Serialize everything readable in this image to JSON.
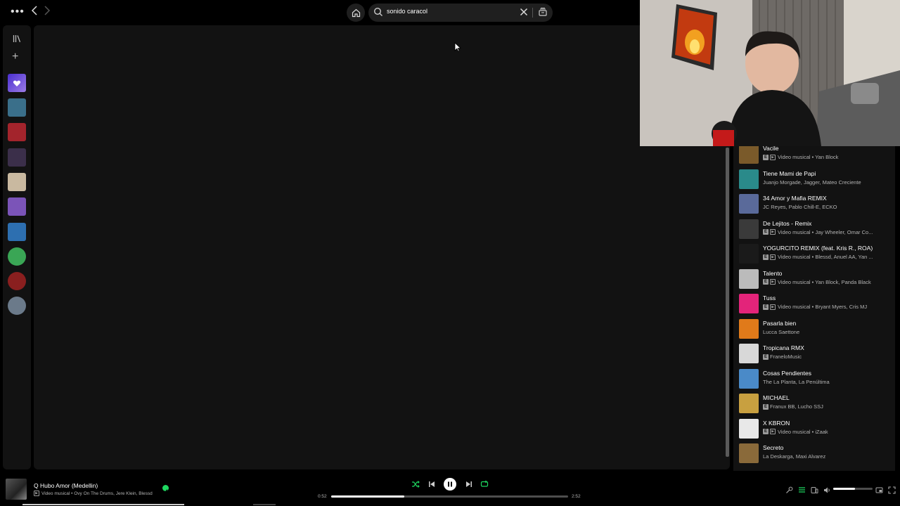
{
  "search": {
    "query": "sonido caracol"
  },
  "sidebar": {
    "items": [
      {
        "name": "liked-songs",
        "color": "#6b4bd6"
      },
      {
        "name": "playlist-1",
        "color": "#3a6f8a"
      },
      {
        "name": "playlist-2",
        "color": "#a3242c"
      },
      {
        "name": "playlist-3",
        "color": "#3b2f4a"
      },
      {
        "name": "playlist-4",
        "color": "#c9b9a0"
      },
      {
        "name": "playlist-5",
        "color": "#7b54b8"
      },
      {
        "name": "playlist-6",
        "color": "#2d6fb0"
      },
      {
        "name": "artist-1",
        "color": "#3aa655"
      },
      {
        "name": "artist-2",
        "color": "#8a1f1f"
      },
      {
        "name": "artist-3",
        "color": "#6b7a8a"
      }
    ]
  },
  "queue": {
    "items": [
      {
        "title": "Vacile",
        "explicit": true,
        "video": true,
        "meta": "Video musical • Yan Block",
        "thumb": "#7a5a2a"
      },
      {
        "title": "Tiene Mami de Papi",
        "explicit": false,
        "video": false,
        "meta": "Juanjo Morgade, Jagger, Mateo Creciente",
        "thumb": "#2a8a8a"
      },
      {
        "title": "34 Amor y Mafia REMIX",
        "explicit": false,
        "video": false,
        "meta": "JC Reyes, Pablo Chill-E, ECKO",
        "thumb": "#5a6a9a"
      },
      {
        "title": "De Lejitos - Remix",
        "explicit": true,
        "video": true,
        "meta": "Video musical • Jay Wheeler, Omar Co...",
        "thumb": "#3a3a3a"
      },
      {
        "title": "YOGURCITO REMIX (feat. Kris R., ROA)",
        "explicit": true,
        "video": true,
        "meta": "Video musical • Blessd, Anuel AA, Yan ...",
        "thumb": "#1a1a1a"
      },
      {
        "title": "Talento",
        "explicit": true,
        "video": true,
        "meta": "Video musical • Yan Block, Panda Black",
        "thumb": "#bbbbbb"
      },
      {
        "title": "Tuss",
        "explicit": true,
        "video": true,
        "meta": "Video musical • Bryant Myers, Cris MJ",
        "thumb": "#e3247a"
      },
      {
        "title": "Pasarla bien",
        "explicit": false,
        "video": false,
        "meta": "Lucca Saettone",
        "thumb": "#e07a1a"
      },
      {
        "title": "Tropicana RMX",
        "explicit": true,
        "video": false,
        "meta": "FraneloMusic",
        "thumb": "#d8d8d8"
      },
      {
        "title": "Cosas Pendientes",
        "explicit": false,
        "video": false,
        "meta": "The La Planta, La Penúltima",
        "thumb": "#4a8ac8"
      },
      {
        "title": "MICHAEL",
        "explicit": true,
        "video": false,
        "meta": "Franux BB, Lucho SSJ",
        "thumb": "#c8a040"
      },
      {
        "title": "X KBRON",
        "explicit": true,
        "video": true,
        "meta": "Video musical • iZaak",
        "thumb": "#e8e8e8"
      },
      {
        "title": "Secreto",
        "explicit": false,
        "video": false,
        "meta": "La Deskarga, Maxi Alvarez",
        "thumb": "#8a6a3a"
      }
    ]
  },
  "player": {
    "title": "Q Hubo Amor (Medellin)",
    "artists": "Video musical • Ovy On The Drums, Jere Klein, Blessd",
    "elapsed": "0:52",
    "duration": "2:52",
    "progress_fraction": 0.31,
    "volume_fraction": 0.55,
    "accent": "#1ed760"
  }
}
